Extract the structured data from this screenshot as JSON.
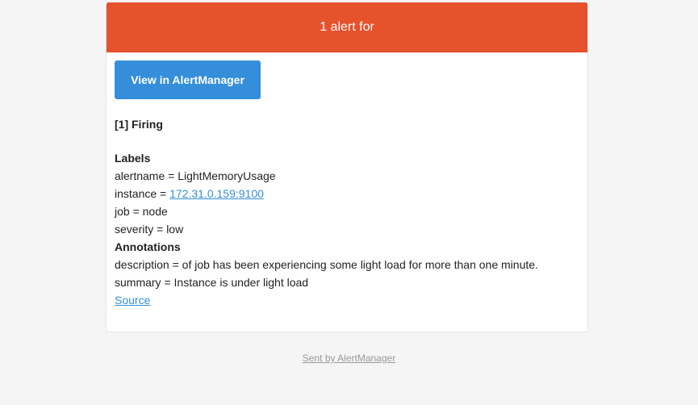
{
  "header": {
    "title": "1 alert for"
  },
  "button": {
    "label": "View in AlertManager"
  },
  "alert": {
    "status": "[1] Firing",
    "labels_heading": "Labels",
    "labels": {
      "alertname": "alertname = LightMemoryUsage",
      "instance_prefix": "instance = ",
      "instance_link": "172.31.0.159:9100",
      "job": "job = node",
      "severity": "severity = low"
    },
    "annotations_heading": "Annotations",
    "annotations": {
      "description": "description = of job has been experiencing some light load for more than one minute.",
      "summary": "summary = Instance is under light load"
    },
    "source_link": "Source"
  },
  "footer": {
    "text": "Sent by AlertManager"
  },
  "colors": {
    "header_bg": "#e6522c",
    "button_bg": "#348eda",
    "link": "#348eda",
    "page_bg": "#f5f5f5"
  }
}
